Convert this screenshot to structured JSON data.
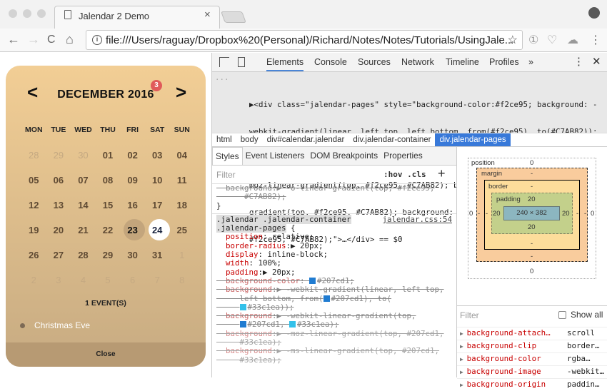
{
  "browser": {
    "tab_title": "Jalendar 2 Demo",
    "tab_close": "×",
    "url": "file:///Users/raguay/Dropbox%20(Personal)/Richard/Notes/Notes/Tutorials/UsingJale...",
    "nav": {
      "back": "←",
      "forward": "→",
      "reload": "C",
      "home": "⌂"
    },
    "icons": {
      "info": "i",
      "star": "☆",
      "ext1": "①",
      "ext2": "♡",
      "ext3": "☁",
      "menu": "⋮"
    }
  },
  "calendar": {
    "prev": "<",
    "next": ">",
    "month_title": "DECEMBER 2016",
    "badge_count": "3",
    "weekdays": [
      "MON",
      "TUE",
      "WED",
      "THU",
      "FRI",
      "SAT",
      "SUN"
    ],
    "weeks": [
      [
        {
          "d": "28",
          "o": true
        },
        {
          "d": "29",
          "o": true
        },
        {
          "d": "30",
          "o": true
        },
        {
          "d": "01"
        },
        {
          "d": "02"
        },
        {
          "d": "03"
        },
        {
          "d": "04"
        }
      ],
      [
        {
          "d": "05"
        },
        {
          "d": "06"
        },
        {
          "d": "07"
        },
        {
          "d": "08"
        },
        {
          "d": "09"
        },
        {
          "d": "10"
        },
        {
          "d": "11"
        }
      ],
      [
        {
          "d": "12"
        },
        {
          "d": "13"
        },
        {
          "d": "14"
        },
        {
          "d": "15"
        },
        {
          "d": "16"
        },
        {
          "d": "17"
        },
        {
          "d": "18"
        }
      ],
      [
        {
          "d": "19"
        },
        {
          "d": "20"
        },
        {
          "d": "21"
        },
        {
          "d": "22"
        },
        {
          "d": "23",
          "sel": true
        },
        {
          "d": "24",
          "today": true,
          "ev": true
        },
        {
          "d": "25",
          "ev": true
        }
      ],
      [
        {
          "d": "26"
        },
        {
          "d": "27"
        },
        {
          "d": "28"
        },
        {
          "d": "29"
        },
        {
          "d": "30"
        },
        {
          "d": "31",
          "ev": true
        },
        {
          "d": "1",
          "o": true
        }
      ],
      [
        {
          "d": "2",
          "o": true
        },
        {
          "d": "3",
          "o": true
        },
        {
          "d": "4",
          "o": true
        },
        {
          "d": "5",
          "o": true
        },
        {
          "d": "6",
          "o": true
        },
        {
          "d": "7",
          "o": true
        },
        {
          "d": "8",
          "o": true
        }
      ]
    ],
    "event_count": "1 EVENT(S)",
    "events": [
      {
        "name": "Christmas Eve"
      }
    ],
    "close_label": "Close",
    "gradient_from": "#f2ce95",
    "gradient_to": "#C7AB82"
  },
  "devtools": {
    "tabs": [
      "Elements",
      "Console",
      "Sources",
      "Network",
      "Timeline",
      "Profiles",
      "»"
    ],
    "active_tab": "Elements",
    "dom_ellipsis": "...",
    "dom_lines": [
      "▶<div class=\"jalendar-pages\" style=\"background-color:#f2ce95; background: -",
      "webkit-gradient(linear, left top, left bottom, from(#f2ce95), to(#C7AB82));",
      "background: -webkit-linear-gradient(top, #f2ce95, #C7AB82); background : -",
      "moz-linear-gradient(top, #f2ce95, #C7AB82); background: -ms-linear-",
      "gradient(top, #f2ce95, #C7AB82); background: -o-linear-gradient(top,",
      "#f2ce95, #C7AB82);\">…</div> == $0"
    ],
    "breadcrumbs": [
      "html",
      "body",
      "div#calendar.jalendar",
      "div.jalendar-container",
      "div.jalendar-pages"
    ],
    "subtabs": [
      "Styles",
      "Event Listeners",
      "DOM Breakpoints",
      "Properties"
    ],
    "filter_placeholder": "Filter",
    "hov_cls": ":hov .cls",
    "plus": "+",
    "styles_prev_rule": [
      "  background:▶ -o-linear-gradient(top, #f2ce95,",
      "      #C7AB82);",
      "}"
    ],
    "rule_selector_1": ".jalendar .jalendar-container",
    "rule_selector_2": ".jalendar-pages {",
    "rule_source": "jalendar.css:54",
    "declarations": [
      {
        "prop": "position",
        "val": " relative;",
        "strike": false
      },
      {
        "prop": "border-radius",
        "val": "▶ 20px;",
        "strike": false
      },
      {
        "prop": "display",
        "val": " inline-block;",
        "strike": false
      },
      {
        "prop": "width",
        "val": " 100%;",
        "strike": false
      },
      {
        "prop": "padding",
        "val": "▶ 20px;",
        "strike": false
      },
      {
        "prop": "background-color",
        "val": " #207cd1;",
        "strike": true,
        "swatches": [
          "#207cd1"
        ]
      },
      {
        "prop": "background",
        "val": "▶ -webkit-gradient(linear, left top,",
        "strike": true
      },
      {
        "cont": "left bottom, from(#207cd1), to(",
        "strike": true
      },
      {
        "cont": "#33c1ea));",
        "strike": true
      },
      {
        "prop": "background",
        "val": "▶ -webkit-linear-gradient(top,",
        "strike": true
      },
      {
        "cont": "#207cd1, #33c1ea);",
        "strike": true
      },
      {
        "prop": "background",
        "val": "▶ -moz-linear-gradient(top, #207cd1,",
        "strike": true,
        "faded": true
      },
      {
        "cont": "#33c1ea);",
        "strike": true,
        "faded": true
      },
      {
        "prop": "background",
        "val": "▶ -ms-linear-gradient(top, #207cd1,",
        "strike": true,
        "faded": true
      },
      {
        "cont": "#33c1ea);",
        "strike": true,
        "faded": true
      }
    ],
    "box_model": {
      "position_label": "position",
      "position_top": "0",
      "position_bottom": "0",
      "position_left": "0",
      "position_right": "0",
      "margin_label": "margin",
      "margin_top": "-",
      "margin_bottom": "-",
      "margin_left": "-",
      "margin_right": "-",
      "border_label": "border",
      "border_top": "-",
      "border_bottom": "-",
      "border_left": "-",
      "border_right": "-",
      "padding_label": "padding",
      "padding_top": "20",
      "padding_bottom": "20",
      "padding_left": "20",
      "padding_right": "20",
      "content": "240 × 382"
    },
    "computed_filter": "Filter",
    "show_all": "Show all",
    "computed": [
      {
        "name": "background-attach…",
        "value": "scroll"
      },
      {
        "name": "background-clip",
        "value": "border…"
      },
      {
        "name": "background-color",
        "value": "rgba…"
      },
      {
        "name": "background-image",
        "value": "-webkit…"
      },
      {
        "name": "background-origin",
        "value": "paddin…"
      }
    ]
  }
}
